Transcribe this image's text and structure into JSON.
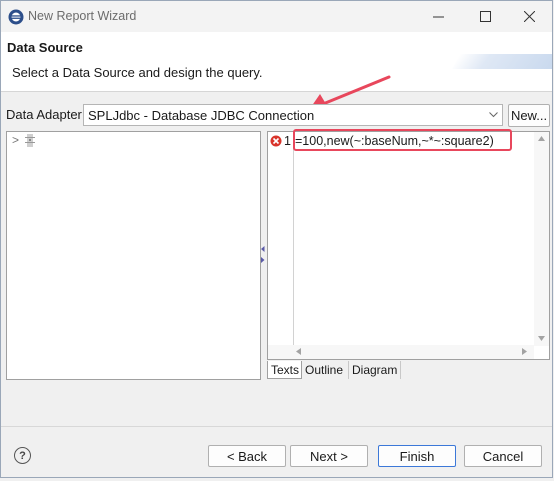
{
  "window": {
    "title": "New Report Wizard"
  },
  "header": {
    "title": "Data Source",
    "description": "Select a Data Source and design the query."
  },
  "adapter": {
    "label": "Data Adapter",
    "value": "SPLJdbc - Database JDBC Connection",
    "new_button": "New..."
  },
  "tree": {
    "expander": ">",
    "node_icon": "database-icon"
  },
  "editor": {
    "line_number": "1",
    "code": "=100,new(~:baseNum,~*~:square2)",
    "error_icon": "error-icon"
  },
  "tabs": [
    "Texts",
    "Outline",
    "Diagram"
  ],
  "buttons": {
    "help": "?",
    "back": "< Back",
    "next": "Next >",
    "finish": "Finish",
    "cancel": "Cancel"
  },
  "colors": {
    "annotation": "#e8475c",
    "error": "#d9342b",
    "default_button_border": "#3c78d8"
  }
}
